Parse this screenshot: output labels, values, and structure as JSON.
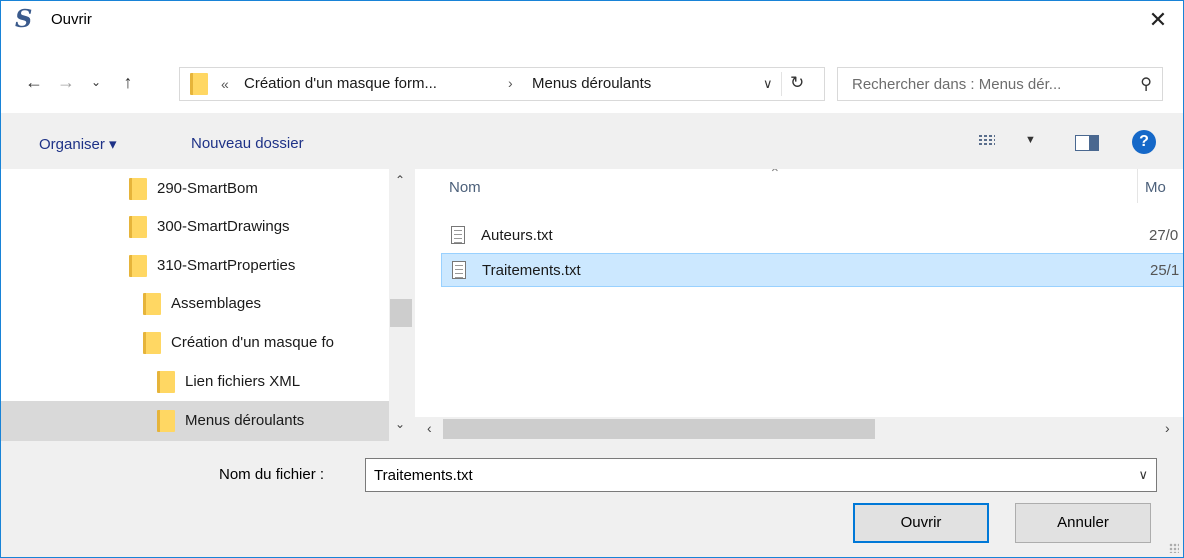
{
  "window": {
    "title": "Ouvrir",
    "app_icon_letter": "S"
  },
  "nav": {
    "back_icon": "arrow-left-icon",
    "forward_icon": "arrow-right-icon",
    "recent_icon": "chevron-down-icon",
    "up_icon": "arrow-up-icon",
    "address": {
      "overflow_chevron": "«",
      "crumbs": [
        "Création d'un masque form...",
        "Menus déroulants"
      ],
      "separator": "›"
    },
    "search_placeholder": "Rechercher dans : Menus dér..."
  },
  "toolbar": {
    "organiser_label": "Organiser ▾",
    "new_folder_label": "Nouveau dossier",
    "view_icon": "view-list-icon",
    "preview_icon": "preview-pane-icon",
    "help_icon": "help-icon"
  },
  "tree": {
    "items": [
      {
        "label": "290-SmartBom",
        "level": 0
      },
      {
        "label": "300-SmartDrawings",
        "level": 0
      },
      {
        "label": "310-SmartProperties",
        "level": 0
      },
      {
        "label": "Assemblages",
        "level": 1
      },
      {
        "label": "Création d'un masque fo",
        "level": 1
      },
      {
        "label": "Lien fichiers XML",
        "level": 2
      },
      {
        "label": "Menus déroulants",
        "level": 2,
        "selected": true
      }
    ]
  },
  "files": {
    "columns": [
      "Nom",
      "Mo"
    ],
    "rows": [
      {
        "name": "Auteurs.txt",
        "date": "27/0"
      },
      {
        "name": "Traitements.txt",
        "date": "25/1",
        "selected": true
      }
    ]
  },
  "bottom": {
    "filename_label": "Nom du fichier :",
    "filename_value": "Traitements.txt",
    "open_label": "Ouvrir",
    "cancel_label": "Annuler"
  },
  "colors": {
    "accent": "#0078d7",
    "selection": "#cce8ff",
    "folder": "#ffd763"
  }
}
